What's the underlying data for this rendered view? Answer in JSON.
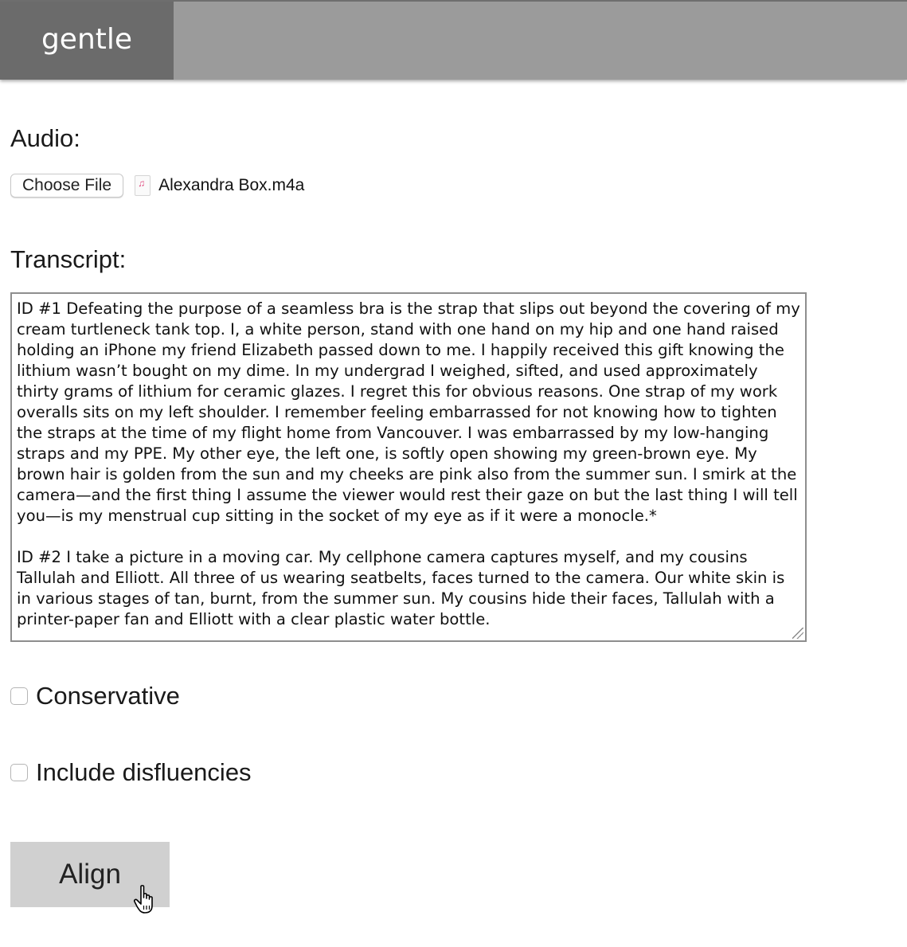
{
  "header": {
    "brand": "gentle"
  },
  "audio": {
    "label": "Audio:",
    "choose_button": "Choose File",
    "file_icon": "music-file-icon",
    "file_name": "Alexandra Box.m4a"
  },
  "transcript": {
    "label": "Transcript:",
    "text": "ID #1 Defeating the purpose of a seamless bra is the strap that slips out beyond the covering of my cream turtleneck tank top. I, a white person, stand with one hand on my hip and one hand raised holding an iPhone my friend Elizabeth passed down to me. I happily received this gift knowing the lithium wasn’t bought on my dime. In my undergrad I weighed, sifted, and used approximately thirty grams of lithium for ceramic glazes. I regret this for obvious reasons. One strap of my work overalls sits on my left shoulder. I remember feeling embarrassed for not knowing how to tighten the straps at the time of my flight home from Vancouver. I was embarrassed by my low-hanging straps and my PPE. My other eye, the left one, is softly open showing my green-brown eye. My brown hair is golden from the sun and my cheeks are pink also from the summer sun. I smirk at the camera—and the first thing I assume the viewer would rest their gaze on but the last thing I will tell you—is my menstrual cup sitting in the socket of my eye as if it were a monocle.*\n\nID #2 I take a picture in a moving car. My cellphone camera captures myself, and my cousins Tallulah and Elliott. All three of us wearing seatbelts, faces turned to the camera. Our white skin is in various stages of tan, burnt, from the summer sun. My cousins hide their faces, Tallulah with a printer-paper fan and Elliott with a clear plastic water bottle."
  },
  "options": {
    "conservative_label": "Conservative",
    "conservative_checked": false,
    "disfluencies_label": "Include disfluencies",
    "disfluencies_checked": false
  },
  "actions": {
    "align_label": "Align",
    "cursor_icon": "hand-pointer-icon"
  }
}
